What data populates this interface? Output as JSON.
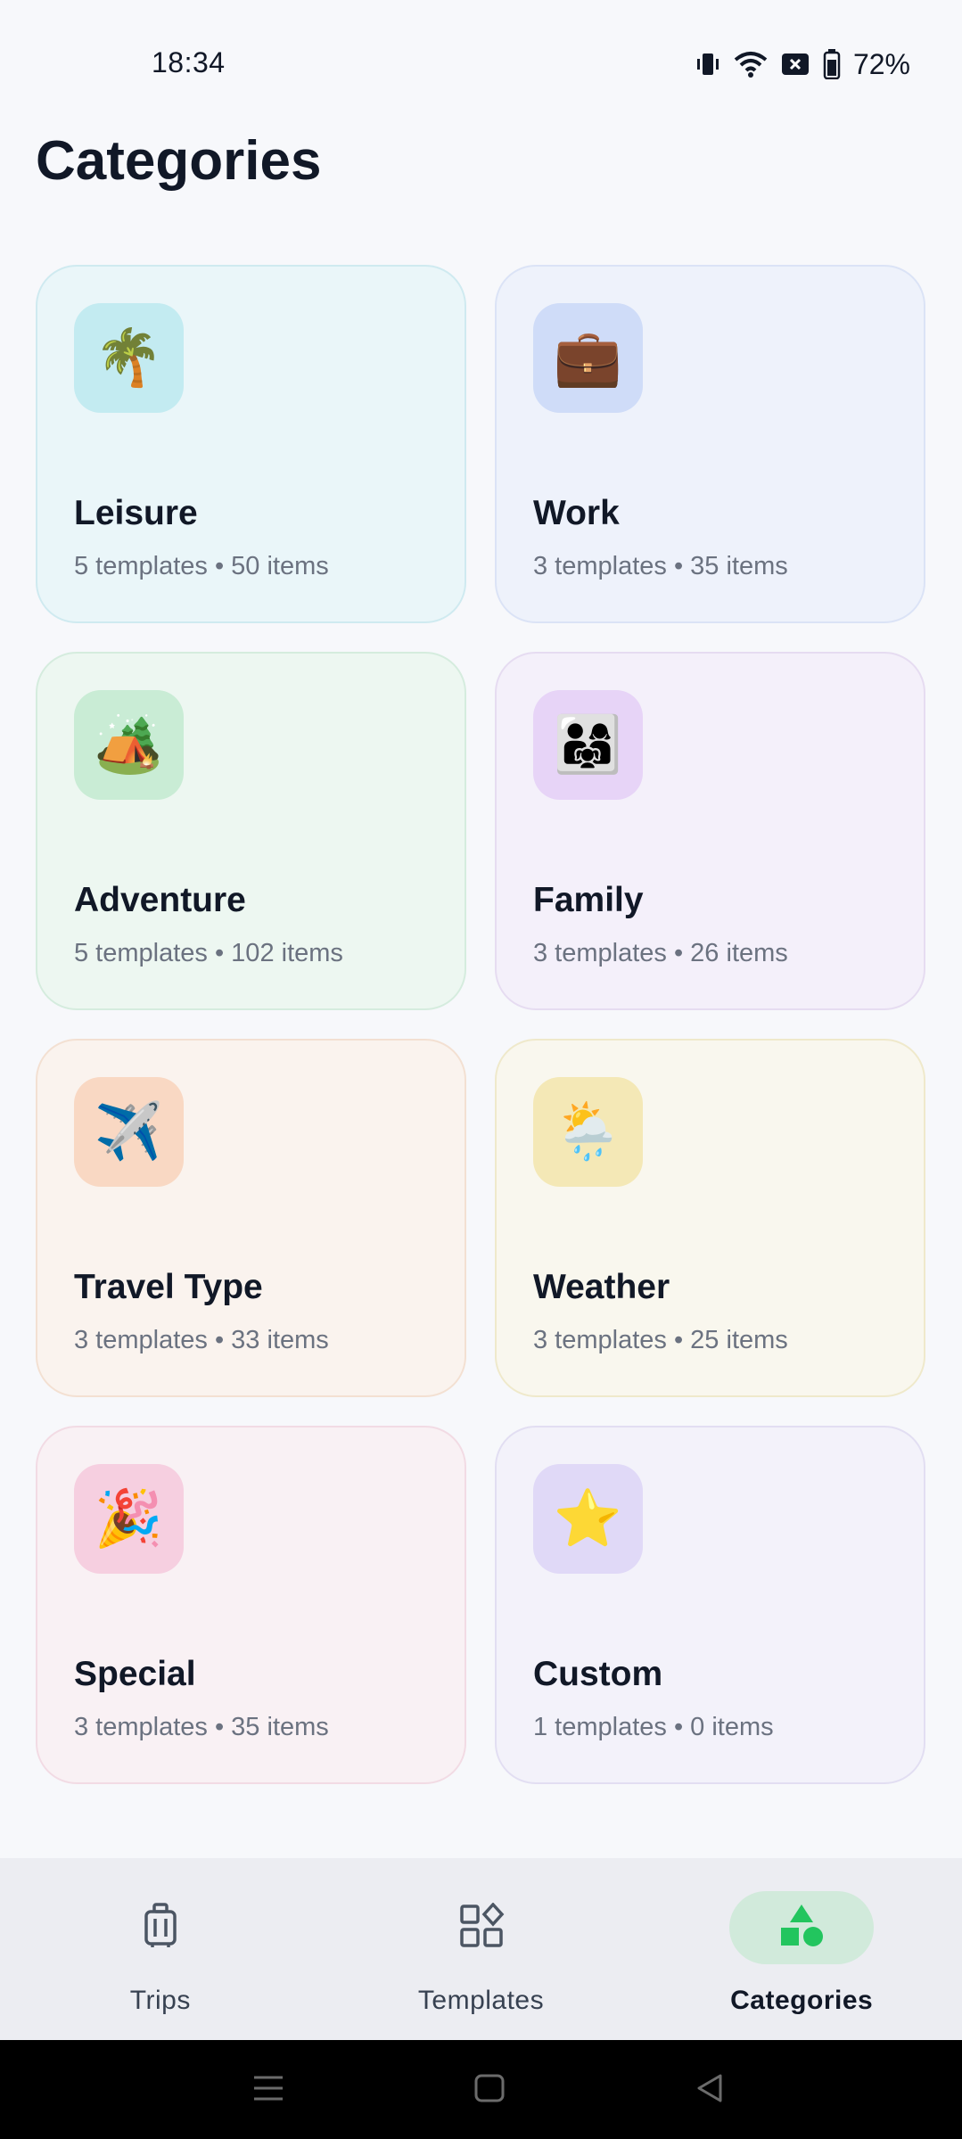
{
  "status": {
    "time": "18:34",
    "battery": "72%",
    "icons": [
      "vibrate-icon",
      "wifi-icon",
      "no-sim-icon",
      "battery-icon"
    ]
  },
  "page": {
    "title": "Categories"
  },
  "categories": [
    {
      "name": "Leisure",
      "subtitle": "5 templates • 50 items",
      "emoji": "🌴",
      "icon": "palm-tree-icon",
      "tint": "#eaf6f9",
      "icon_bg": "#c3ebf1",
      "border": "#cfeaf0"
    },
    {
      "name": "Work",
      "subtitle": "3 templates • 35 items",
      "emoji": "💼",
      "icon": "briefcase-icon",
      "tint": "#eef2fb",
      "icon_bg": "#cfdcf8",
      "border": "#dbe3f6"
    },
    {
      "name": "Adventure",
      "subtitle": "5 templates • 102 items",
      "emoji": "🏕️",
      "icon": "camping-icon",
      "tint": "#edf7f1",
      "icon_bg": "#c9ecd5",
      "border": "#d5ecde"
    },
    {
      "name": "Family",
      "subtitle": "3 templates • 26 items",
      "emoji": "👨‍👩‍👧",
      "icon": "family-icon",
      "tint": "#f4f0fa",
      "icon_bg": "#e7d4f7",
      "border": "#e6dcf1"
    },
    {
      "name": "Travel Type",
      "subtitle": "3 templates • 33 items",
      "emoji": "✈️",
      "icon": "airplane-icon",
      "tint": "#faf3ee",
      "icon_bg": "#f9d8c3",
      "border": "#f3e0d2"
    },
    {
      "name": "Weather",
      "subtitle": "3 templates • 25 items",
      "emoji": "🌦️",
      "icon": "weather-icon",
      "tint": "#f9f7ee",
      "icon_bg": "#f4e8b6",
      "border": "#efe9cb"
    },
    {
      "name": "Special",
      "subtitle": "3 templates • 35 items",
      "emoji": "🎉",
      "icon": "party-popper-icon",
      "tint": "#f9f1f4",
      "icon_bg": "#f6cfe0",
      "border": "#f2dbe4"
    },
    {
      "name": "Custom",
      "subtitle": "1 templates • 0 items",
      "emoji": "⭐",
      "icon": "star-icon",
      "tint": "#f3f2fa",
      "icon_bg": "#e0d9f7",
      "border": "#e2def2"
    }
  ],
  "nav": {
    "items": [
      {
        "label": "Trips",
        "icon": "luggage-icon",
        "active": false
      },
      {
        "label": "Templates",
        "icon": "templates-icon",
        "active": false
      },
      {
        "label": "Categories",
        "icon": "categories-icon",
        "active": true
      }
    ],
    "active_color": "#22c55e",
    "active_bg": "#d1eadb"
  },
  "system_nav": [
    "menu-icon",
    "home-icon",
    "back-icon"
  ]
}
